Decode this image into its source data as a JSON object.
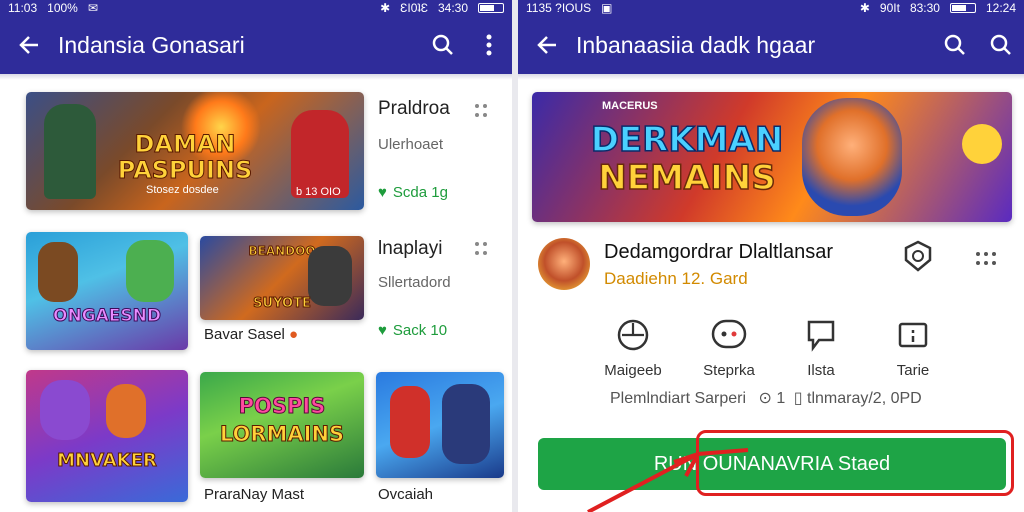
{
  "left": {
    "status": {
      "time": "11:03",
      "extra": "100%",
      "signal": "ƐI0ʇƐ",
      "clock": "34:30"
    },
    "title": "Indansia Gonasari",
    "featured": {
      "art_title_line1": "DAMAN",
      "art_title_line2": "PASPUINS",
      "art_subtitle": "Stosez dosdee",
      "art_corner": "b 13 OIO",
      "title": "Praldroa",
      "subtitle": "Ulerhoaet",
      "rating": "Scda 1g"
    },
    "row2": {
      "tile1_art": "ONGAESND",
      "tile2_art_top": "BEANDOO",
      "tile2_art_bottom": "SUYOTE",
      "tile2_caption": "Bavar Sasel",
      "title": "lnaplayi",
      "subtitle": "Sllertadord",
      "rating": "Sack 10"
    },
    "row3": {
      "tile1_art": "MNVAKER",
      "tile2_art_top": "POSPIS",
      "tile2_art_bottom": "LORMAINS",
      "tile2_caption": "PraraNay Mast",
      "tile3_caption": "Ovcaiah"
    }
  },
  "right": {
    "status": {
      "time": "1135 ?IOUS",
      "clock": "83:30",
      "right": "12:24",
      "signal": "90It"
    },
    "title": "Inbanaasiia dadk hgaar",
    "banner": {
      "art_line1": "DERKMAN",
      "art_line2": "NEMAINS",
      "art_sub": "MACERUS"
    },
    "developer": {
      "name": "Dedamgordrar Dlaltlansar",
      "meta": "Daadiehn 12. Gard"
    },
    "actions": [
      {
        "label": "Maigeeb",
        "icon": "controller-icon"
      },
      {
        "label": "Steprka",
        "icon": "chat-bubble-icon"
      },
      {
        "label": "Ilsta",
        "icon": "speech-flag-icon"
      },
      {
        "label": "Tarie",
        "icon": "info-card-icon"
      }
    ],
    "info": "Plemlndiart Sarperi",
    "info_counter": "1",
    "info_stats": "tlnmaray/2, 0PD",
    "install_label": "RUN OUNANAVRIA Staed"
  },
  "colors": {
    "app_bar": "#2f2c9a",
    "install": "#1ea446",
    "highlight": "#e02020",
    "rating": "#1e9c3c"
  }
}
